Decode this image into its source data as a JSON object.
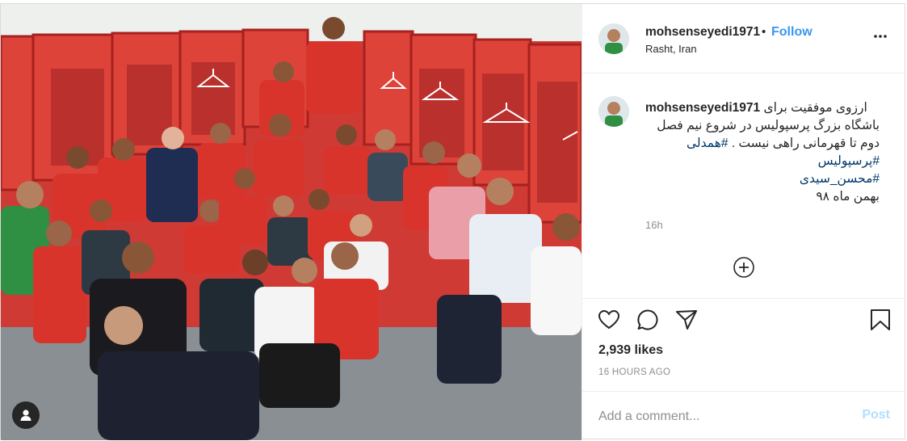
{
  "post": {
    "username": "mohsenseyedi1971",
    "separator": "•",
    "follow_label": "Follow",
    "location": "Rasht, Iran",
    "caption": {
      "username": "mohsenseyedi1971",
      "line1": "ارزوی موفقیت برای",
      "line2": "باشگاه بزرگ پرسپولیس در شروع نیم فصل",
      "line3": "دوم تا قهرمانی راهی نیست .",
      "hashtag1": "#همدلی",
      "hashtag2": "#پرسپولیس",
      "hashtag3": "#محسن_سیدی",
      "line4": "بهمن ماه ۹۸",
      "time": "16h"
    },
    "likes": "2,939 likes",
    "posted_ago": "16 HOURS AGO",
    "comment_placeholder": "Add a comment...",
    "post_label": "Post"
  },
  "icons": {
    "more": "more-options-icon",
    "load_more": "load-more-comments-icon",
    "like": "heart-icon",
    "comment": "comment-icon",
    "share": "share-icon",
    "save": "bookmark-icon",
    "tag": "user-tag-icon"
  },
  "colors": {
    "link": "#3897f0",
    "hashtag": "#00376b",
    "muted": "#8e8e8e",
    "post_disabled": "#b2dffc",
    "locker_red": "#d63a33"
  }
}
